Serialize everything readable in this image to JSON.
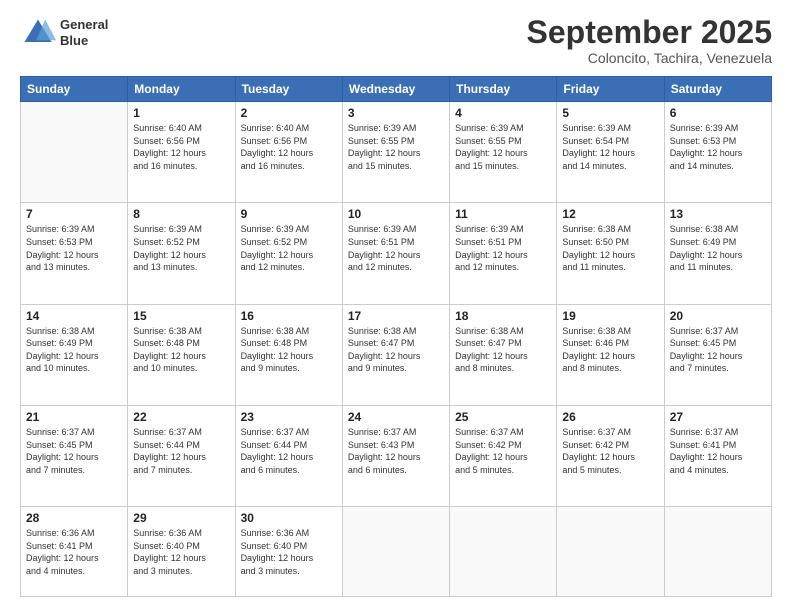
{
  "header": {
    "logo_line1": "General",
    "logo_line2": "Blue",
    "title": "September 2025",
    "subtitle": "Coloncito, Tachira, Venezuela"
  },
  "weekdays": [
    "Sunday",
    "Monday",
    "Tuesday",
    "Wednesday",
    "Thursday",
    "Friday",
    "Saturday"
  ],
  "weeks": [
    [
      {
        "day": "",
        "info": ""
      },
      {
        "day": "1",
        "info": "Sunrise: 6:40 AM\nSunset: 6:56 PM\nDaylight: 12 hours\nand 16 minutes."
      },
      {
        "day": "2",
        "info": "Sunrise: 6:40 AM\nSunset: 6:56 PM\nDaylight: 12 hours\nand 16 minutes."
      },
      {
        "day": "3",
        "info": "Sunrise: 6:39 AM\nSunset: 6:55 PM\nDaylight: 12 hours\nand 15 minutes."
      },
      {
        "day": "4",
        "info": "Sunrise: 6:39 AM\nSunset: 6:55 PM\nDaylight: 12 hours\nand 15 minutes."
      },
      {
        "day": "5",
        "info": "Sunrise: 6:39 AM\nSunset: 6:54 PM\nDaylight: 12 hours\nand 14 minutes."
      },
      {
        "day": "6",
        "info": "Sunrise: 6:39 AM\nSunset: 6:53 PM\nDaylight: 12 hours\nand 14 minutes."
      }
    ],
    [
      {
        "day": "7",
        "info": "Sunrise: 6:39 AM\nSunset: 6:53 PM\nDaylight: 12 hours\nand 13 minutes."
      },
      {
        "day": "8",
        "info": "Sunrise: 6:39 AM\nSunset: 6:52 PM\nDaylight: 12 hours\nand 13 minutes."
      },
      {
        "day": "9",
        "info": "Sunrise: 6:39 AM\nSunset: 6:52 PM\nDaylight: 12 hours\nand 12 minutes."
      },
      {
        "day": "10",
        "info": "Sunrise: 6:39 AM\nSunset: 6:51 PM\nDaylight: 12 hours\nand 12 minutes."
      },
      {
        "day": "11",
        "info": "Sunrise: 6:39 AM\nSunset: 6:51 PM\nDaylight: 12 hours\nand 12 minutes."
      },
      {
        "day": "12",
        "info": "Sunrise: 6:38 AM\nSunset: 6:50 PM\nDaylight: 12 hours\nand 11 minutes."
      },
      {
        "day": "13",
        "info": "Sunrise: 6:38 AM\nSunset: 6:49 PM\nDaylight: 12 hours\nand 11 minutes."
      }
    ],
    [
      {
        "day": "14",
        "info": "Sunrise: 6:38 AM\nSunset: 6:49 PM\nDaylight: 12 hours\nand 10 minutes."
      },
      {
        "day": "15",
        "info": "Sunrise: 6:38 AM\nSunset: 6:48 PM\nDaylight: 12 hours\nand 10 minutes."
      },
      {
        "day": "16",
        "info": "Sunrise: 6:38 AM\nSunset: 6:48 PM\nDaylight: 12 hours\nand 9 minutes."
      },
      {
        "day": "17",
        "info": "Sunrise: 6:38 AM\nSunset: 6:47 PM\nDaylight: 12 hours\nand 9 minutes."
      },
      {
        "day": "18",
        "info": "Sunrise: 6:38 AM\nSunset: 6:47 PM\nDaylight: 12 hours\nand 8 minutes."
      },
      {
        "day": "19",
        "info": "Sunrise: 6:38 AM\nSunset: 6:46 PM\nDaylight: 12 hours\nand 8 minutes."
      },
      {
        "day": "20",
        "info": "Sunrise: 6:37 AM\nSunset: 6:45 PM\nDaylight: 12 hours\nand 7 minutes."
      }
    ],
    [
      {
        "day": "21",
        "info": "Sunrise: 6:37 AM\nSunset: 6:45 PM\nDaylight: 12 hours\nand 7 minutes."
      },
      {
        "day": "22",
        "info": "Sunrise: 6:37 AM\nSunset: 6:44 PM\nDaylight: 12 hours\nand 7 minutes."
      },
      {
        "day": "23",
        "info": "Sunrise: 6:37 AM\nSunset: 6:44 PM\nDaylight: 12 hours\nand 6 minutes."
      },
      {
        "day": "24",
        "info": "Sunrise: 6:37 AM\nSunset: 6:43 PM\nDaylight: 12 hours\nand 6 minutes."
      },
      {
        "day": "25",
        "info": "Sunrise: 6:37 AM\nSunset: 6:42 PM\nDaylight: 12 hours\nand 5 minutes."
      },
      {
        "day": "26",
        "info": "Sunrise: 6:37 AM\nSunset: 6:42 PM\nDaylight: 12 hours\nand 5 minutes."
      },
      {
        "day": "27",
        "info": "Sunrise: 6:37 AM\nSunset: 6:41 PM\nDaylight: 12 hours\nand 4 minutes."
      }
    ],
    [
      {
        "day": "28",
        "info": "Sunrise: 6:36 AM\nSunset: 6:41 PM\nDaylight: 12 hours\nand 4 minutes."
      },
      {
        "day": "29",
        "info": "Sunrise: 6:36 AM\nSunset: 6:40 PM\nDaylight: 12 hours\nand 3 minutes."
      },
      {
        "day": "30",
        "info": "Sunrise: 6:36 AM\nSunset: 6:40 PM\nDaylight: 12 hours\nand 3 minutes."
      },
      {
        "day": "",
        "info": ""
      },
      {
        "day": "",
        "info": ""
      },
      {
        "day": "",
        "info": ""
      },
      {
        "day": "",
        "info": ""
      }
    ]
  ]
}
